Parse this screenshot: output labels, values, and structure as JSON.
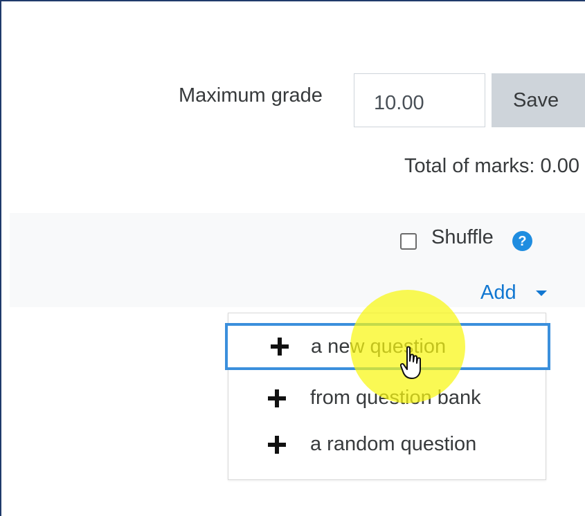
{
  "grade": {
    "label": "Maximum grade",
    "value": "10.00",
    "save_label": "Save"
  },
  "total_marks": "Total of marks: 0.00",
  "shuffle": {
    "label": "Shuffle",
    "checked": false,
    "help_icon": "question-circle-icon",
    "help_glyph": "?"
  },
  "add_menu": {
    "label": "Add",
    "caret_icon": "caret-down-icon",
    "items": [
      {
        "icon": "plus-icon",
        "label": "a new question",
        "active": true
      },
      {
        "icon": "plus-icon",
        "label": "from question bank",
        "active": false
      },
      {
        "icon": "plus-icon",
        "label": "a random question",
        "active": false
      }
    ]
  },
  "cursor_icon": "hand-pointer-icon",
  "colors": {
    "link": "#1177d1",
    "help_icon": "#1f8de0",
    "focus_border": "#3b8fdc",
    "save_button_bg": "#ced4da",
    "click_highlight": "#f8f612",
    "panel_bg": "#f8f9fa"
  }
}
